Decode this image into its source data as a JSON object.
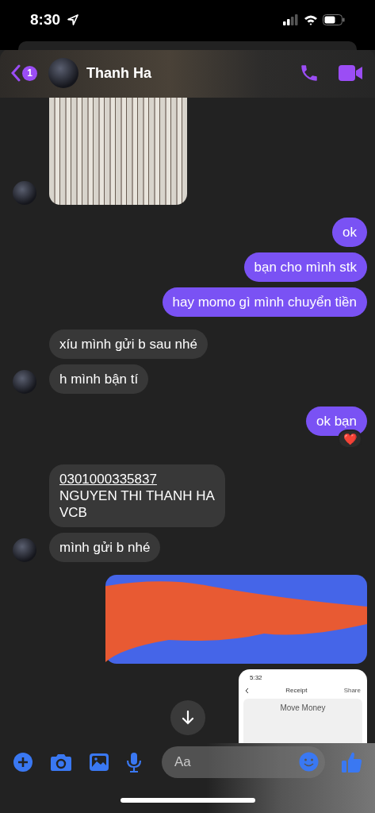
{
  "status_bar": {
    "time": "8:30"
  },
  "header": {
    "unread_count": "1",
    "contact_name": "Thanh Ha"
  },
  "messages": [
    {
      "outgoing": false,
      "kind": "photo",
      "avatar": true
    },
    {
      "outgoing": true,
      "kind": "text",
      "lines": [
        "ok"
      ]
    },
    {
      "outgoing": true,
      "kind": "text",
      "lines": [
        "bạn cho mình stk"
      ]
    },
    {
      "outgoing": true,
      "kind": "text",
      "lines": [
        "hay momo gì mình chuyển tiền"
      ]
    },
    {
      "outgoing": false,
      "kind": "text",
      "lines": [
        "xíu mình gửi b sau nhé"
      ]
    },
    {
      "outgoing": false,
      "kind": "text",
      "lines": [
        "h mình bận tí"
      ],
      "avatar": true
    },
    {
      "outgoing": true,
      "kind": "text",
      "lines": [
        "ok bạn"
      ],
      "reaction": "❤️"
    },
    {
      "outgoing": false,
      "kind": "account",
      "link": "0301000335837",
      "lines": [
        "NGUYEN THI THANH HA",
        "VCB"
      ]
    },
    {
      "outgoing": false,
      "kind": "text",
      "lines": [
        "mình gửi b nhé"
      ],
      "avatar": true
    },
    {
      "outgoing": true,
      "kind": "redacted"
    },
    {
      "outgoing": true,
      "kind": "receipt",
      "receipt": {
        "time": "5:32",
        "title": "Receipt",
        "action": "Share",
        "heading": "Move Money"
      }
    }
  ],
  "composer": {
    "placeholder": "Aa"
  }
}
